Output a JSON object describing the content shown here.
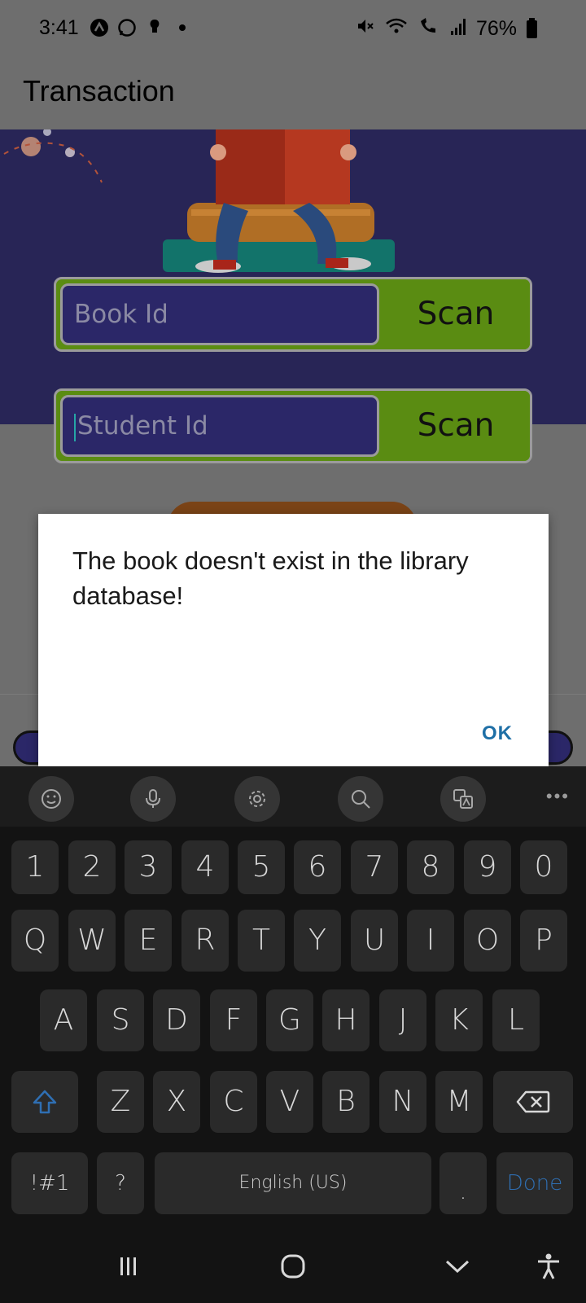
{
  "status_bar": {
    "time": "3:41",
    "battery": "76%",
    "left_icons": [
      "app-a-icon",
      "whatsapp-icon",
      "bulb-icon",
      "dot-icon"
    ],
    "right_icons": [
      "mute-icon",
      "wifi-icon",
      "wifi-call-icon",
      "signal-icon",
      "battery-icon"
    ]
  },
  "app_bar": {
    "title": "Transaction"
  },
  "form": {
    "book_id": {
      "placeholder": "Book Id",
      "scan_label": "Scan"
    },
    "student_id": {
      "placeholder": "Student Id",
      "scan_label": "Scan"
    }
  },
  "dialog": {
    "message": "The book doesn't exist in the library database!",
    "ok_label": "OK"
  },
  "keyboard": {
    "toolbar": [
      "emoji-icon",
      "mic-icon",
      "settings-icon",
      "search-icon",
      "translate-icon",
      "more-icon"
    ],
    "row_numbers": [
      "1",
      "2",
      "3",
      "4",
      "5",
      "6",
      "7",
      "8",
      "9",
      "0"
    ],
    "row_q": [
      "Q",
      "W",
      "E",
      "R",
      "T",
      "Y",
      "U",
      "I",
      "O",
      "P"
    ],
    "row_a": [
      "A",
      "S",
      "D",
      "F",
      "G",
      "H",
      "J",
      "K",
      "L"
    ],
    "row_z": [
      "Z",
      "X",
      "C",
      "V",
      "B",
      "N",
      "M"
    ],
    "symbols_label": "!#1",
    "question_label": "?",
    "space_label": "English (US)",
    "period_label": ".",
    "done_label": "Done"
  },
  "colors": {
    "hero_bg": "#282556",
    "field_bg": "#2b2768",
    "scan_bg": "#5a8c12",
    "dialog_ok": "#1e6fa6",
    "done_key": "#2f6fb3"
  }
}
